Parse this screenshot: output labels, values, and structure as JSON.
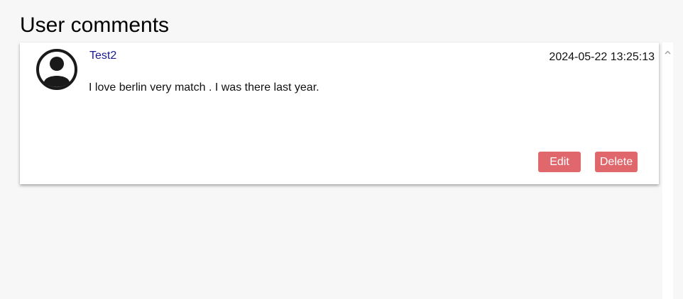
{
  "page": {
    "title": "User comments"
  },
  "comments": [
    {
      "author": "Test2",
      "timestamp": "2024-05-22 13:25:13",
      "text": "I love berlin very match . I was there last year.",
      "edit_label": "Edit",
      "delete_label": "Delete"
    }
  ],
  "icons": {
    "avatar": "user-avatar-icon",
    "scroll_up": "chevron-up-icon"
  },
  "colors": {
    "author_link": "#1a1a8c",
    "button_bg": "#e0676b",
    "button_text": "#ffffff",
    "page_bg": "#f7f7f7"
  }
}
